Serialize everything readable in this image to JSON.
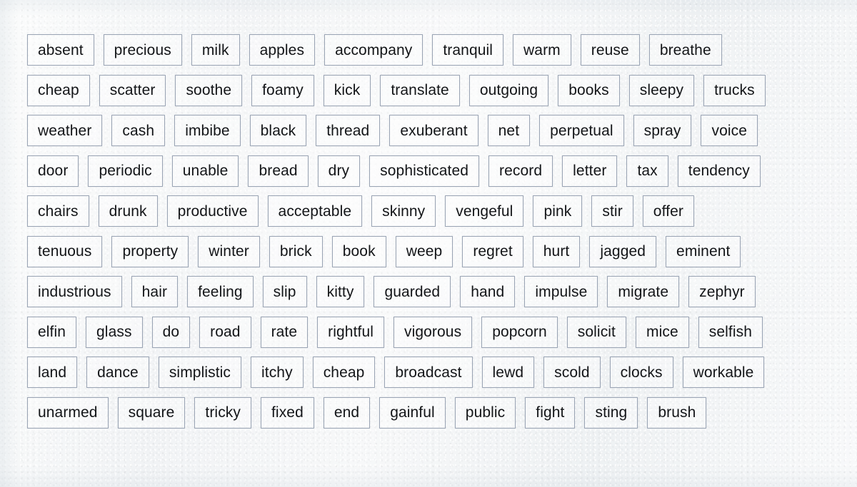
{
  "page": {
    "kind": "word-bank-grid",
    "background_color": "#f3f5f6",
    "box_border_color": "#9aa4b4",
    "text_color": "#131518",
    "row_count": 10
  },
  "rows": [
    {
      "words": [
        "absent",
        "precious",
        "milk",
        "apples",
        "accompany",
        "tranquil",
        "warm",
        "reuse",
        "breathe"
      ]
    },
    {
      "words": [
        "cheap",
        "scatter",
        "soothe",
        "foamy",
        "kick",
        "translate",
        "outgoing",
        "books",
        "sleepy",
        "trucks"
      ]
    },
    {
      "words": [
        "weather",
        "cash",
        "imbibe",
        "black",
        "thread",
        "exuberant",
        "net",
        "perpetual",
        "spray",
        "voice"
      ]
    },
    {
      "words": [
        "door",
        "periodic",
        "unable",
        "bread",
        "dry",
        "sophisticated",
        "record",
        "letter",
        "tax",
        "tendency"
      ]
    },
    {
      "words": [
        "chairs",
        "drunk",
        "productive",
        "acceptable",
        "skinny",
        "vengeful",
        "pink",
        "stir",
        "offer"
      ]
    },
    {
      "words": [
        "tenuous",
        "property",
        "winter",
        "brick",
        "book",
        "weep",
        "regret",
        "hurt",
        "jagged",
        "eminent"
      ]
    },
    {
      "words": [
        "industrious",
        "hair",
        "feeling",
        "slip",
        "kitty",
        "guarded",
        "hand",
        "impulse",
        "migrate",
        "zephyr"
      ]
    },
    {
      "words": [
        "elfin",
        "glass",
        "do",
        "road",
        "rate",
        "rightful",
        "vigorous",
        "popcorn",
        "solicit",
        "mice",
        "selfish"
      ]
    },
    {
      "words": [
        "land",
        "dance",
        "simplistic",
        "itchy",
        "cheap",
        "broadcast",
        "lewd",
        "scold",
        "clocks",
        "workable"
      ]
    },
    {
      "words": [
        "unarmed",
        "square",
        "tricky",
        "fixed",
        "end",
        "gainful",
        "public",
        "fight",
        "sting",
        "brush"
      ]
    }
  ]
}
